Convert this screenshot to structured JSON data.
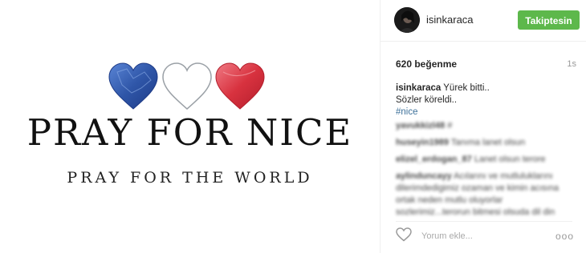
{
  "post": {
    "image": {
      "main_text": "PRAY FOR NICE",
      "sub_text": "PRAY FOR THE WORLD",
      "heart_colors": [
        "#2f56a8",
        "#ffffff",
        "#d8323f"
      ]
    },
    "header": {
      "username": "isinkaraca",
      "follow_label": "Takiptesin"
    },
    "likes_text": "620 beğenme",
    "time_ago": "1s",
    "caption": {
      "username": "isinkaraca",
      "line1": "Yürek bitti..",
      "line2": "Sözler köreldi..",
      "hashtag": "#nice"
    },
    "comments": [
      {
        "user": "yavukkizl48",
        "text": "#"
      },
      {
        "user": "huseyin1989",
        "text": "Tanıma lanet olsun"
      },
      {
        "user": "elizel_erdogan_87",
        "text": "Lanet olsun terore"
      },
      {
        "user": "aylinduncayy",
        "text": "Acılarını ve mutluluklarını"
      },
      {
        "user": "",
        "text": "dilerimdedigimiz ozaman ve kimin acısına"
      },
      {
        "user": "",
        "text": "ortak neden mutlu oluyorlar"
      },
      {
        "user": "",
        "text": "sozlerimiz...terorun bitmesi olsuda dil din"
      }
    ],
    "comment_placeholder": "Yorum ekle...",
    "more_label": "ooo"
  }
}
